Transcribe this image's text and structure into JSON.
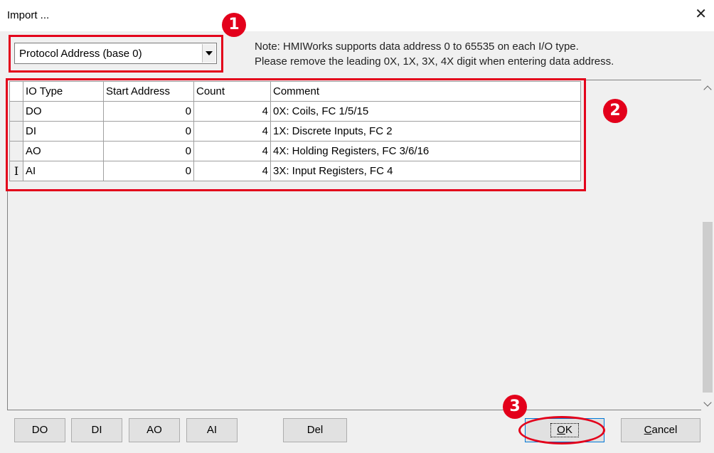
{
  "window": {
    "title": "Import ...",
    "close_icon": "close-icon"
  },
  "address_mode": {
    "selected": "Protocol Address (base 0)"
  },
  "note": {
    "line1": "Note: HMIWorks supports data address 0 to 65535 on each I/O type.",
    "line2": "Please remove the leading 0X, 1X, 3X, 4X digit when entering data address."
  },
  "table": {
    "headers": [
      "IO Type",
      "Start Address",
      "Count",
      "Comment"
    ],
    "rows": [
      {
        "io_type": "DO",
        "start": "0",
        "count": "4",
        "comment": "0X: Coils, FC 1/5/15"
      },
      {
        "io_type": "DI",
        "start": "0",
        "count": "4",
        "comment": "1X: Discrete Inputs, FC 2"
      },
      {
        "io_type": "AO",
        "start": "0",
        "count": "4",
        "comment": "4X: Holding Registers, FC 3/6/16"
      },
      {
        "io_type": "AI",
        "start": "0",
        "count": "4",
        "comment": "3X: Input Registers, FC 4"
      }
    ],
    "row_cursor": "I"
  },
  "buttons": {
    "do": "DO",
    "di": "DI",
    "ao": "AO",
    "ai": "AI",
    "del": "Del",
    "ok_k": "K",
    "ok_o": "O",
    "cancel_c": "C",
    "cancel_rest": "ancel"
  },
  "annotations": {
    "badge1": "1",
    "badge2": "2",
    "badge3": "3",
    "color": "#e3001b"
  }
}
